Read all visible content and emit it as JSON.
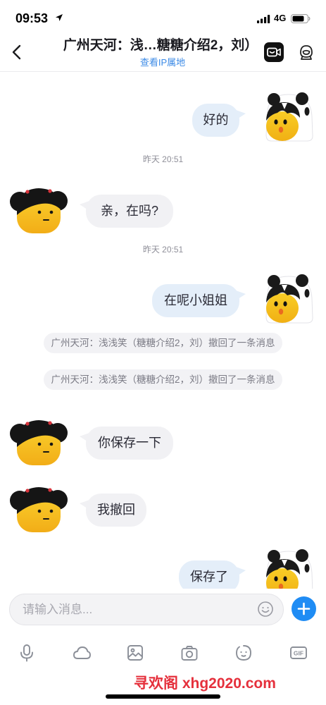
{
  "status_bar": {
    "time": "09:53",
    "network": "4G",
    "location_icon": "location-arrow-icon",
    "signal_icon": "cellular-signal-icon",
    "battery_icon": "battery-icon",
    "battery_level": 0.8
  },
  "header": {
    "back_icon": "chevron-left-icon",
    "title": "广州天河：浅…糖糖介绍2，刘）",
    "subtitle": "查看IP属地",
    "video_icon": "video-call-icon",
    "profile_icon": "astronaut-icon"
  },
  "avatars": {
    "self": "panda-chick-avatar",
    "contact": "pigtail-girl-avatar"
  },
  "messages": [
    {
      "sent": "好的"
    },
    {
      "timestamp": "昨天 20:51"
    },
    {
      "received": "亲，在吗?"
    },
    {
      "timestamp": "昨天 20:51"
    },
    {
      "sent": "在呢小姐姐"
    },
    {
      "system_notice": "广州天河：浅浅笑（糖糖介绍2，刘）撤回了一条消息"
    },
    {
      "system_notice": "广州天河：浅浅笑（糖糖介绍2，刘）撤回了一条消息"
    },
    {
      "received": "你保存一下"
    },
    {
      "received": "我撤回"
    },
    {
      "sent": "保存了"
    }
  ],
  "composer": {
    "placeholder": "请输入消息...",
    "emoji_icon": "smiley-icon",
    "plus_icon": "plus-icon"
  },
  "toolbar": {
    "items": [
      {
        "icon": "microphone-icon"
      },
      {
        "icon": "cloud-icon"
      },
      {
        "icon": "image-icon"
      },
      {
        "icon": "camera-icon"
      },
      {
        "icon": "ghost-face-icon"
      },
      {
        "icon": "gif-icon",
        "label": "GIF"
      }
    ]
  },
  "watermark": "寻欢阁 xhg2020.com",
  "colors": {
    "accent": "#1f8cf4",
    "sent_bubble": "#e4eef9",
    "received_bubble": "#f1f1f4",
    "subtitle_link": "#3b8ae6",
    "watermark": "#e5303c"
  }
}
